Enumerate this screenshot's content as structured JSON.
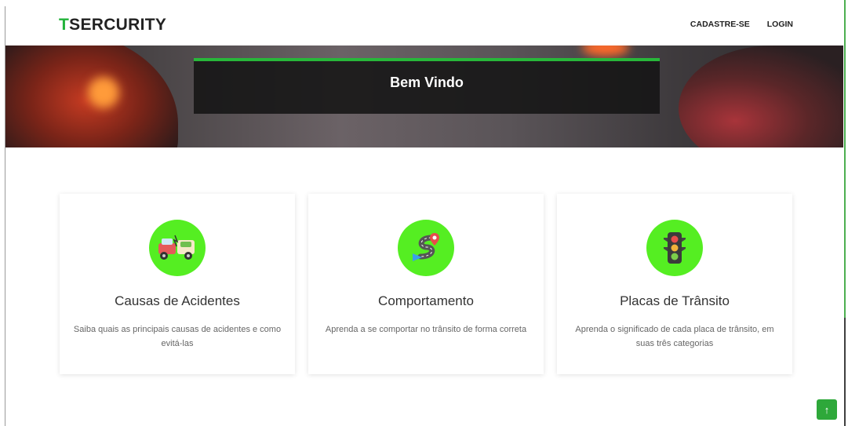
{
  "header": {
    "logo_accent": "T",
    "logo_rest": "SERCURITY",
    "nav": [
      {
        "label": "CADASTRE-SE"
      },
      {
        "label": "LOGIN"
      }
    ]
  },
  "hero": {
    "title": "Bem Vindo"
  },
  "cards": [
    {
      "icon": "car-crash-icon",
      "title": "Causas de Acidentes",
      "description": "Saiba quais as principais causas de acidentes e como evitá-las"
    },
    {
      "icon": "route-icon",
      "title": "Comportamento",
      "description": "Aprenda a se comportar no trânsito de forma correta"
    },
    {
      "icon": "traffic-light-icon",
      "title": "Placas de Trânsito",
      "description": "Aprenda o significado de cada placa de trânsito, em suas três categorias"
    }
  ],
  "colors": {
    "accent": "#22b33a",
    "icon_bg": "#55ee22",
    "back_to_top": "#2ea83a"
  },
  "back_to_top": {
    "icon": "arrow-up-icon",
    "label": "↑"
  }
}
